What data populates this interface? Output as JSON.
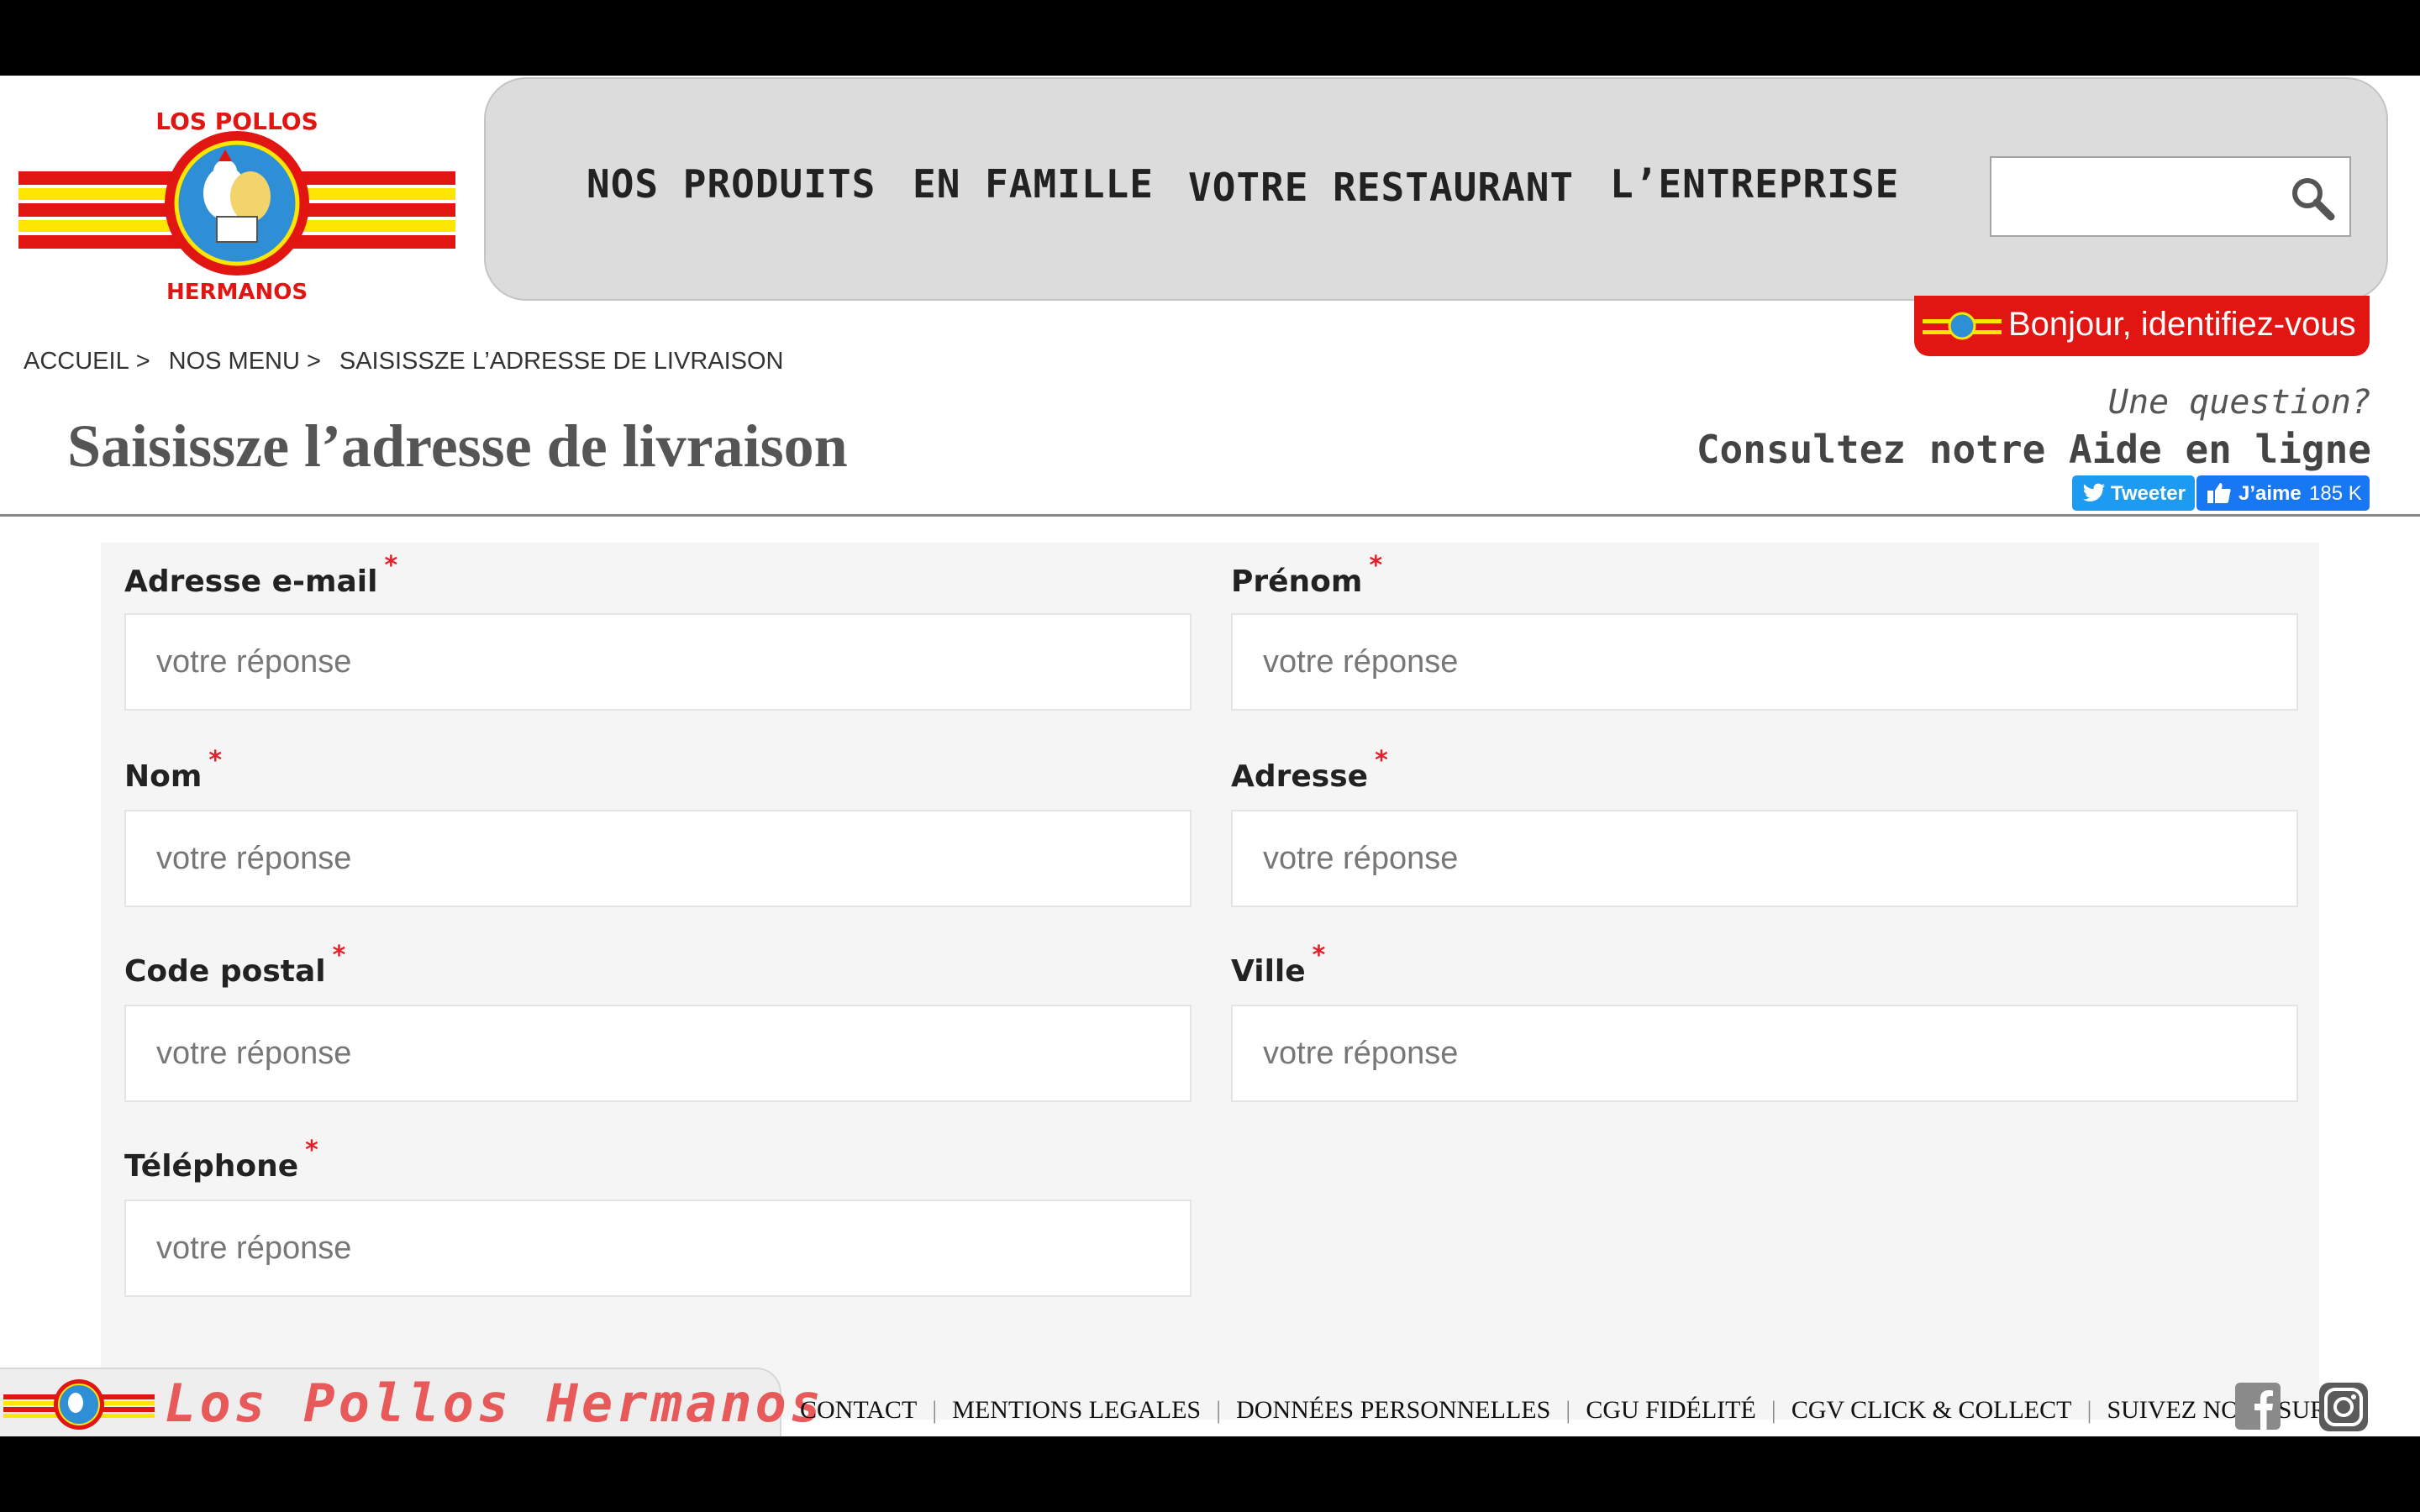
{
  "brand": {
    "logo_text_top": "LOS POLLOS",
    "logo_text_bottom": "HERMANOS",
    "footer_name": "Los Pollos Hermanos"
  },
  "nav": {
    "items": [
      {
        "label": "NOS PRODUITS"
      },
      {
        "label": "EN FAMILLE"
      },
      {
        "label": "VOTRE RESTAURANT"
      },
      {
        "label": "L’ENTREPRISE"
      }
    ],
    "search_value": ""
  },
  "login": {
    "label": "Bonjour, identifiez-vous"
  },
  "breadcrumb": {
    "items": [
      {
        "label": "ACCUEIL"
      },
      {
        "label": "NOS MENU"
      },
      {
        "label": "SAISISSZE L’ADRESSE DE LIVRAISON"
      }
    ],
    "separator": ">"
  },
  "page": {
    "title": "Saisissze l’adresse de livraison"
  },
  "help": {
    "question": "Une question?",
    "link": "Consultez notre Aide en ligne"
  },
  "social": {
    "tweet_label": "Tweeter",
    "like_label": "J’aime",
    "like_count": "185 K"
  },
  "form": {
    "required_marker": "*",
    "fields": [
      {
        "label": "Adresse e-mail",
        "placeholder": "votre réponse"
      },
      {
        "label": "Prénom",
        "placeholder": "votre réponse"
      },
      {
        "label": "Nom",
        "placeholder": "votre réponse"
      },
      {
        "label": "Adresse",
        "placeholder": "votre réponse"
      },
      {
        "label": "Code postal",
        "placeholder": "votre réponse"
      },
      {
        "label": "Ville",
        "placeholder": "votre réponse"
      },
      {
        "label": "Téléphone",
        "placeholder": "votre réponse"
      }
    ]
  },
  "footer": {
    "links": [
      {
        "label": "CONTACT"
      },
      {
        "label": "MENTIONS LEGALES"
      },
      {
        "label": "DONNÉES PERSONNELLES"
      },
      {
        "label": "CGU FIDÉLITÉ"
      },
      {
        "label": "CGV CLICK & COLLECT"
      },
      {
        "label": "SUIVEZ NOUS SUR"
      }
    ],
    "separator": "|",
    "social_icons": [
      "facebook-icon",
      "instagram-icon"
    ]
  },
  "colors": {
    "brand_red": "#e11512",
    "brand_yellow": "#ffe600",
    "required_red": "#e0202a",
    "nav_bg": "#dcdcdc",
    "form_bg": "#f5f5f5"
  }
}
